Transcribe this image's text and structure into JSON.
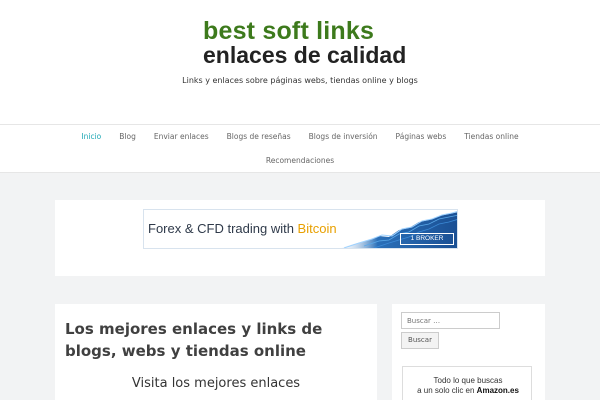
{
  "header": {
    "logo_line1": "best soft links",
    "logo_line2": "enlaces de calidad",
    "tagline": "Links y enlaces sobre páginas webs, tiendas online y blogs"
  },
  "nav": {
    "items": [
      {
        "label": "Inicio",
        "active": true
      },
      {
        "label": "Blog"
      },
      {
        "label": "Enviar enlaces"
      },
      {
        "label": "Blogs de reseñas"
      },
      {
        "label": "Blogs de inversión"
      },
      {
        "label": "Páginas webs"
      },
      {
        "label": "Tiendas online"
      },
      {
        "label": "Recomendaciones"
      }
    ]
  },
  "banner": {
    "text_part1": "Forex & CFD trading with ",
    "text_accent": "Bitcoin",
    "brand": "1 BROKER"
  },
  "main": {
    "title": "Los mejores enlaces y links de blogs, webs y tiendas online",
    "subtitle": "Visita los mejores enlaces"
  },
  "sidebar": {
    "search": {
      "placeholder": "Buscar …",
      "button_label": "Buscar"
    },
    "amazon": {
      "line1": "Todo lo que buscas",
      "line2_prefix": "a un solo clic en ",
      "line2_brand": "Amazon.es"
    }
  },
  "colors": {
    "logo_green": "#3d7a1c",
    "nav_active": "#1fa8b5",
    "page_bg": "#f2f3f4",
    "banner_accent": "#e8a000"
  }
}
